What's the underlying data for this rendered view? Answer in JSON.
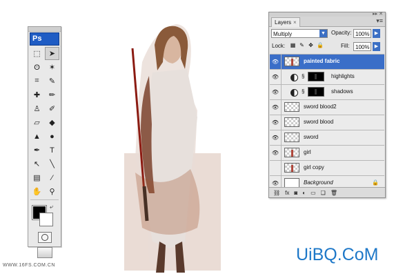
{
  "toolbox": {
    "logo": "Ps",
    "tools": [
      {
        "icon": "marquee-icon",
        "glyph": "⬚",
        "active": false
      },
      {
        "icon": "move-icon",
        "glyph": "➤",
        "active": true
      },
      {
        "icon": "lasso-icon",
        "glyph": "ʘ",
        "active": false
      },
      {
        "icon": "magic-wand-icon",
        "glyph": "✶",
        "active": false
      },
      {
        "icon": "crop-icon",
        "glyph": "⌗",
        "active": false
      },
      {
        "icon": "eyedropper-icon",
        "glyph": "✎",
        "active": false
      },
      {
        "icon": "healing-brush-icon",
        "glyph": "✚",
        "active": false
      },
      {
        "icon": "brush-icon",
        "glyph": "✏",
        "active": false
      },
      {
        "icon": "clone-stamp-icon",
        "glyph": "♙",
        "active": false
      },
      {
        "icon": "history-brush-icon",
        "glyph": "✐",
        "active": false
      },
      {
        "icon": "eraser-icon",
        "glyph": "▱",
        "active": false
      },
      {
        "icon": "paint-bucket-icon",
        "glyph": "◆",
        "active": false
      },
      {
        "icon": "blur-icon",
        "glyph": "▲",
        "active": false
      },
      {
        "icon": "dodge-icon",
        "glyph": "●",
        "active": false
      },
      {
        "icon": "pen-icon",
        "glyph": "✒",
        "active": false
      },
      {
        "icon": "type-icon",
        "glyph": "T",
        "active": false
      },
      {
        "icon": "path-selection-icon",
        "glyph": "↖",
        "active": false
      },
      {
        "icon": "line-icon",
        "glyph": "╲",
        "active": false
      },
      {
        "icon": "notes-icon",
        "glyph": "▤",
        "active": false
      },
      {
        "icon": "eyedropper-sample-icon",
        "glyph": "⁄",
        "active": false
      },
      {
        "icon": "hand-icon",
        "glyph": "✋",
        "active": false
      },
      {
        "icon": "zoom-icon",
        "glyph": "⚲",
        "active": false
      }
    ],
    "foreground_color": "#000000",
    "background_color": "#ffffff"
  },
  "layers_panel": {
    "tab_label": "Layers",
    "tab_close": "×",
    "blend_mode": "Multiply",
    "opacity_label": "Opacity:",
    "opacity_value": "100%",
    "lock_label": "Lock:",
    "fill_label": "Fill:",
    "fill_value": "100%",
    "layers": [
      {
        "name": "painted fabric",
        "selected": true,
        "type": "normal",
        "visible": true,
        "style": "bold",
        "thumb": "fig"
      },
      {
        "name": "highlights",
        "selected": false,
        "type": "adjustment",
        "visible": true,
        "style": "normal"
      },
      {
        "name": "shadows",
        "selected": false,
        "type": "adjustment",
        "visible": true,
        "style": "normal"
      },
      {
        "name": "sword blood2",
        "selected": false,
        "type": "normal",
        "visible": true,
        "style": "normal",
        "thumb": "checker"
      },
      {
        "name": "sword blood",
        "selected": false,
        "type": "normal",
        "visible": true,
        "style": "normal",
        "thumb": "checker"
      },
      {
        "name": "sword",
        "selected": false,
        "type": "normal",
        "visible": true,
        "style": "normal",
        "thumb": "checker"
      },
      {
        "name": "girl",
        "selected": false,
        "type": "normal",
        "visible": true,
        "style": "normal",
        "thumb": "fig"
      },
      {
        "name": "girl copy",
        "selected": false,
        "type": "normal",
        "visible": false,
        "style": "normal",
        "thumb": "fig"
      },
      {
        "name": "Background",
        "selected": false,
        "type": "normal",
        "visible": true,
        "style": "italic",
        "thumb": "white",
        "locked": true
      }
    ],
    "bottom_icons": [
      "link-icon",
      "fx-icon",
      "mask-icon",
      "adjustment-icon",
      "folder-icon",
      "new-layer-icon",
      "trash-icon"
    ]
  },
  "watermarks": {
    "left": "WWW.16FS.COM.CN",
    "right": "UiBQ.CoM"
  }
}
